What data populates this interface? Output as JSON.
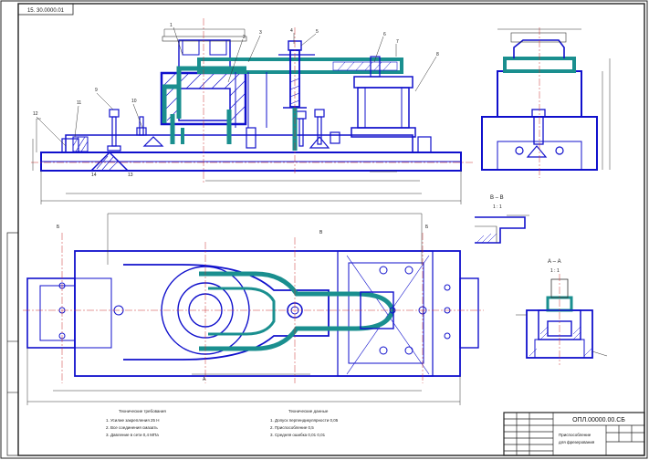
{
  "drawing": {
    "stamp_top": "15. 30.0000.01",
    "title_block": {
      "designation": "ОПЛ.00000.00.СБ",
      "name_line1": "Приспособление",
      "name_line2": "для фрезерования"
    },
    "notes": {
      "tech_req_title": "Технические требования",
      "left": [
        "1. Усилие закрепления 25 Н",
        "2. Все соединения смазать",
        "3. Давление в сети 0,4 МПа"
      ],
      "right_title": "Технические данные",
      "right": [
        "1. Допуск перпендикулярности 0,05",
        "2. Приспособление 0,5",
        "3. Средняя ошибка 0,01 0,01"
      ]
    },
    "section_labels": {
      "view_vv": "В – В",
      "scale_vv": "1 : 1",
      "view_aa": "А – А",
      "scale_aa": "1 : 1"
    },
    "callouts": {
      "front": [
        "1",
        "2",
        "3",
        "4",
        "5",
        "6",
        "7",
        "8",
        "9",
        "10",
        "11",
        "12",
        "13",
        "14"
      ],
      "plan": [
        "Б",
        "В",
        "А",
        "Б"
      ]
    }
  }
}
